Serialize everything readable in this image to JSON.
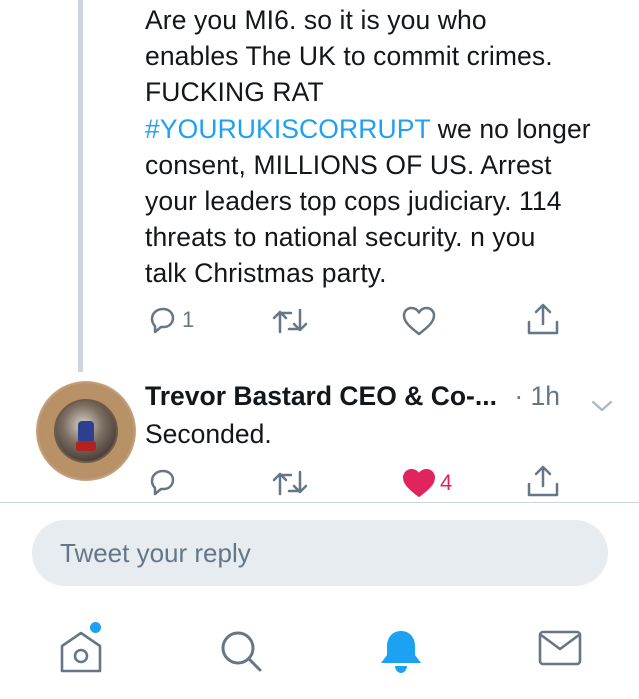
{
  "tweet": {
    "lines": [
      "Are you MI6. so it is you who",
      "enables The UK to commit crimes.",
      "FUCKING RAT",
      "we no longer",
      "consent, MILLIONS OF US. Arrest",
      "your leaders top cops judiciary. 114",
      "threats to national security. n you",
      "talk Christmas party."
    ],
    "hashtag": "#YOURUKISCORRUPT",
    "reply_count": "1",
    "retweet_count": "",
    "like_count": ""
  },
  "reply": {
    "author": "Trevor Bastard CEO & Co-...",
    "time": "· 1h",
    "text": "Seconded.",
    "reply_count": "",
    "retweet_count": "",
    "like_count": "4",
    "liked": true
  },
  "composer": {
    "placeholder": "Tweet your reply"
  },
  "colors": {
    "accent": "#1da1f2",
    "like": "#e0245e",
    "icon": "#657786",
    "reply_box_bg": "#e6ecf0",
    "thread_line": "#ccd6dd"
  },
  "icons": {
    "reply": "reply-icon",
    "retweet": "retweet-icon",
    "like": "heart-icon",
    "share": "share-icon",
    "home": "home-icon",
    "search": "search-icon",
    "notifications": "bell-icon",
    "messages": "mail-icon"
  }
}
